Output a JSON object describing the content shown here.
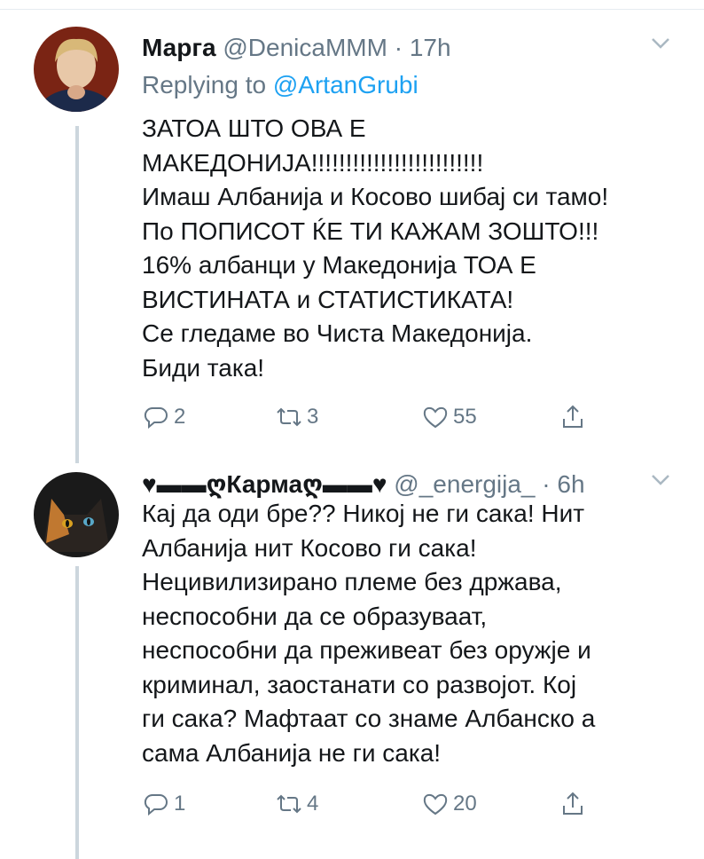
{
  "tweets": [
    {
      "display_name": "Марга",
      "handle": "@DenicaMMM",
      "separator": "·",
      "time": "17h",
      "replying_prefix": "Replying to",
      "replying_to": "@ArtanGrubi",
      "body_lines": [
        "ЗАТОА ШТО ОВА Е",
        "МАКЕДОНИЈА!!!!!!!!!!!!!!!!!!!!!!!!!",
        "Имаш Албанија и Косово шибај си тамо!",
        "По ПОПИСОТ ЌЕ ТИ КАЖАМ ЗОШТО!!!",
        "16% албанци у Македонија ТОА Е",
        "ВИСТИНАТА и СТАТИСТИКАТА!",
        "Се гледаме во Чиста Македонија.",
        "Биди така!"
      ],
      "replies": "2",
      "retweets": "3",
      "likes": "55"
    },
    {
      "display_name": "♥▬▬ღКармаღ▬▬♥",
      "handle": "@_energija_",
      "separator": "·",
      "time": "6h",
      "body_lines": [
        "Кај да оди бре?? Никој не ги сака! Нит",
        "Албанија нит Косово ги сака!",
        "Нецивилизирано племе без држава,",
        "неспособни да се образуваат,",
        "неспособни да преживеат без оружје и",
        "криминал, заостанати со развојот. Кој",
        "ги сака? Мафтаат со знаме Албанско а",
        "сама Албанија не ги сака!"
      ],
      "replies": "1",
      "retweets": "4",
      "likes": "20"
    }
  ],
  "colors": {
    "text": "#14171a",
    "secondary": "#657786",
    "link": "#1da1f2",
    "thread_line": "#ccd6dd"
  },
  "icons": [
    "reply-icon",
    "retweet-icon",
    "like-icon",
    "share-icon",
    "caret-down-icon"
  ]
}
